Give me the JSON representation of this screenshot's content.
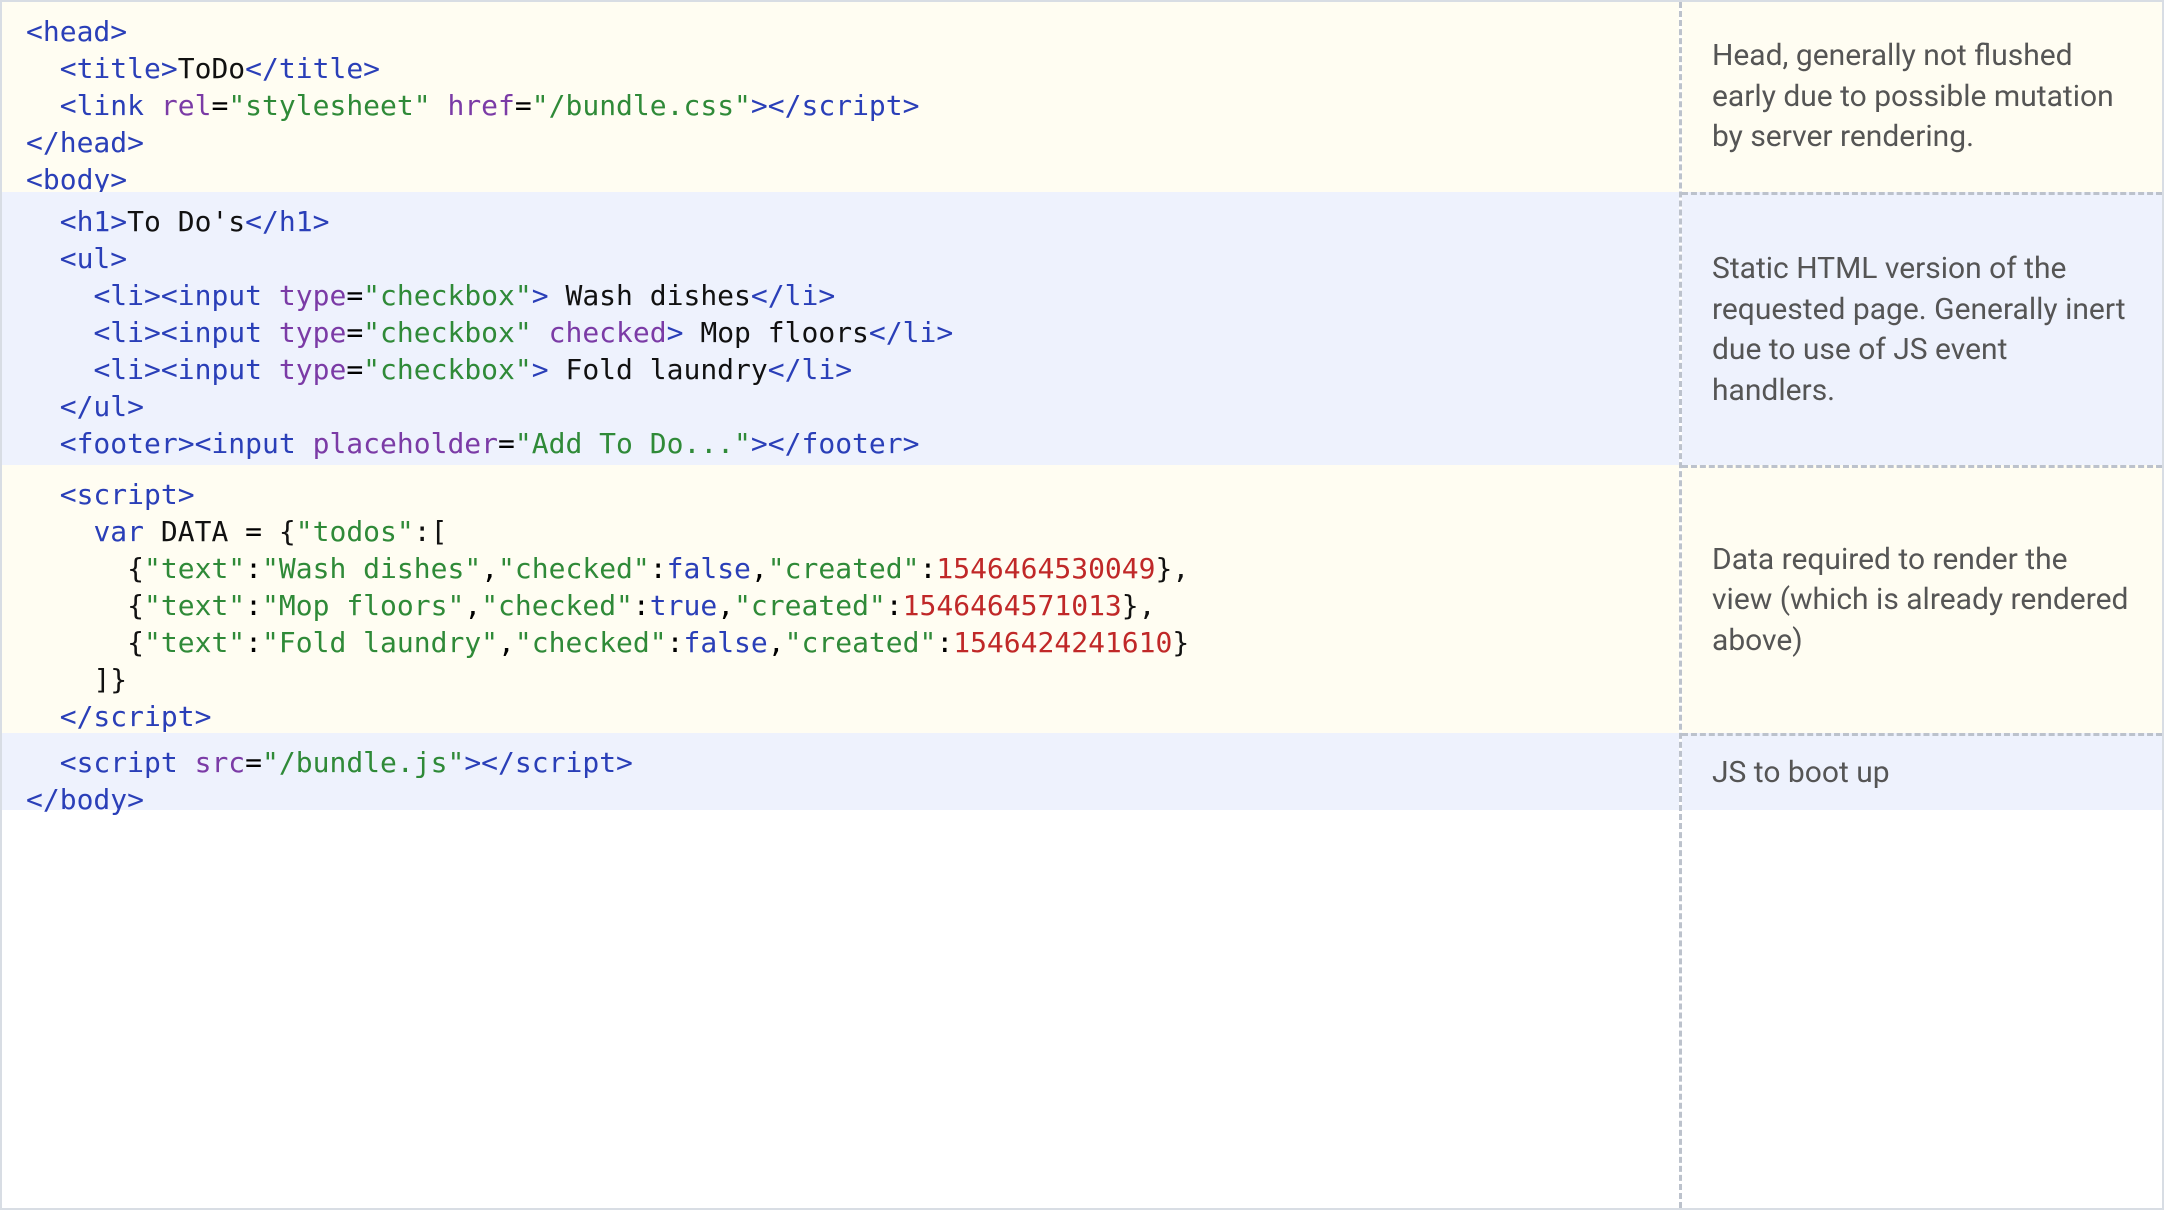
{
  "descriptions": {
    "r1": "Head, generally not flushed early due to possible mutation by server rendering.",
    "r2": "Static HTML version of the requested page. Generally inert due to use of JS event handlers.",
    "r3": "Data required to render the view (which is already rendered above)",
    "r4": "JS to boot up"
  },
  "code": {
    "title_text": "ToDo",
    "link_rel": "\"stylesheet\"",
    "link_href": "\"/bundle.css\"",
    "h1_text": "To Do's",
    "li1_type": "\"checkbox\"",
    "li1_text": " Wash dishes",
    "li2_type": "\"checkbox\"",
    "li2_checked": "checked",
    "li2_text": " Mop floors",
    "li3_type": "\"checkbox\"",
    "li3_text": " Fold laundry",
    "footer_placeholder": "\"Add To Do...\"",
    "var_kw": "var",
    "data_name": "DATA",
    "d_open": "{",
    "d_todos_key": "\"todos\"",
    "d_colon_open": ":[",
    "t1_open": "{",
    "t1_text_k": "\"text\"",
    "t1_text_v": "\"Wash dishes\"",
    "t1_checked_k": "\"checked\"",
    "t1_checked_v": "false",
    "t1_created_k": "\"created\"",
    "t1_created_v": "1546464530049",
    "t1_close": "},",
    "t2_open": "{",
    "t2_text_k": "\"text\"",
    "t2_text_v": "\"Mop floors\"",
    "t2_checked_k": "\"checked\"",
    "t2_checked_v": "true",
    "t2_created_k": "\"created\"",
    "t2_created_v": "1546464571013",
    "t2_close": "},",
    "t3_open": "{",
    "t3_text_k": "\"text\"",
    "t3_text_v": "\"Fold laundry\"",
    "t3_checked_k": "\"checked\"",
    "t3_checked_v": "false",
    "t3_created_k": "\"created\"",
    "t3_created_v": "1546424241610",
    "t3_close": "}",
    "d_close": "]}",
    "script_src": "\"/bundle.js\""
  }
}
